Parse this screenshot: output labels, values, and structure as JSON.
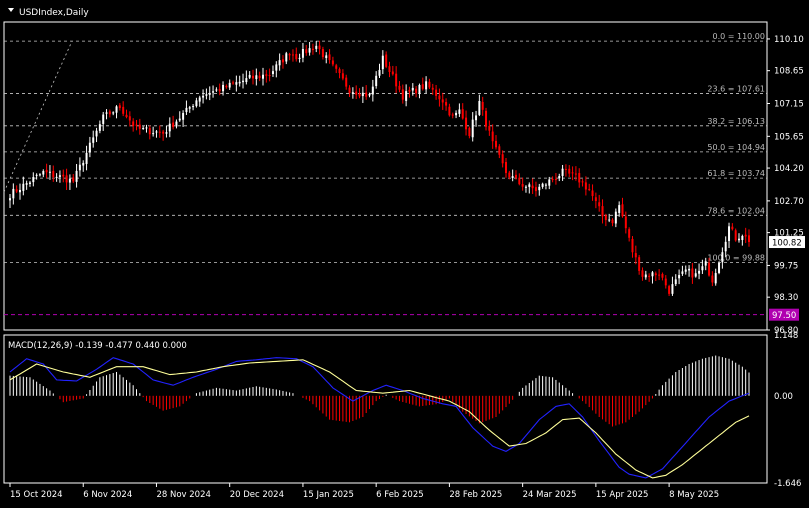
{
  "header": {
    "symbol_label": "USDIndex,Daily",
    "arrow_icon": "triangle-down-icon"
  },
  "colors": {
    "background": "#000000",
    "bull": "#ffffff",
    "bear": "#ff0000",
    "fib_line": "#c8c8c8",
    "macd_line": "#2222ff",
    "signal_line": "#ffff99",
    "level_magenta": "#b000b0",
    "price_box_bg": "#ffffff",
    "price_box_fg": "#000000"
  },
  "chart_data": [
    {
      "type": "candlestick",
      "title": "USDIndex,Daily",
      "ylim": [
        96.8,
        110.6
      ],
      "y_ticks": [
        110.1,
        108.65,
        107.15,
        105.65,
        104.2,
        102.7,
        101.25,
        99.75,
        98.3,
        96.8
      ],
      "x_ticks": [
        "15 Oct 2024",
        "6 Nov 2024",
        "28 Nov 2024",
        "20 Dec 2024",
        "15 Jan 2025",
        "6 Feb 2025",
        "28 Feb 2025",
        "24 Mar 2025",
        "15 Apr 2025",
        "8 May 2025"
      ],
      "current_price": 100.82,
      "level_marker": 97.5,
      "fib_levels": [
        {
          "label": "0.0 = 110.00",
          "value": 110.0
        },
        {
          "label": "23.6 = 107.61",
          "value": 107.61
        },
        {
          "label": "38.2 = 106.13",
          "value": 106.13
        },
        {
          "label": "50.0 = 104.94",
          "value": 104.94
        },
        {
          "label": "61.8 = 103.74",
          "value": 103.74
        },
        {
          "label": "78.6 = 102.04",
          "value": 102.04
        },
        {
          "label": "100.0 = 99.88",
          "value": 99.88
        }
      ],
      "anchors": [
        [
          0,
          103.0
        ],
        [
          10,
          104.0
        ],
        [
          15,
          103.8
        ],
        [
          19,
          103.6
        ],
        [
          28,
          106.5
        ],
        [
          33,
          107.0
        ],
        [
          38,
          106.0
        ],
        [
          46,
          105.8
        ],
        [
          53,
          106.8
        ],
        [
          57,
          107.5
        ],
        [
          63,
          107.8
        ],
        [
          72,
          108.3
        ],
        [
          78,
          108.5
        ],
        [
          84,
          109.5
        ],
        [
          86,
          109.3
        ],
        [
          92,
          109.8
        ],
        [
          98,
          108.6
        ],
        [
          102,
          107.8
        ],
        [
          108,
          107.5
        ],
        [
          112,
          109.2
        ],
        [
          118,
          107.5
        ],
        [
          125,
          108.0
        ],
        [
          130,
          107.3
        ],
        [
          133,
          106.5
        ],
        [
          135,
          106.8
        ],
        [
          138,
          105.8
        ],
        [
          141,
          107.2
        ],
        [
          145,
          105.3
        ],
        [
          149,
          104.0
        ],
        [
          153,
          103.5
        ],
        [
          158,
          103.2
        ],
        [
          162,
          103.6
        ],
        [
          166,
          104.0
        ],
        [
          170,
          103.8
        ],
        [
          174,
          103.2
        ],
        [
          178,
          102.0
        ],
        [
          181,
          101.8
        ],
        [
          183,
          102.5
        ],
        [
          187,
          100.4
        ],
        [
          190,
          99.3
        ],
        [
          195,
          99.4
        ],
        [
          198,
          98.6
        ],
        [
          200,
          99.0
        ],
        [
          203,
          99.5
        ],
        [
          206,
          99.3
        ],
        [
          209,
          99.8
        ],
        [
          211,
          99.1
        ],
        [
          213,
          100.0
        ],
        [
          216,
          101.5
        ],
        [
          218,
          101.0
        ],
        [
          220,
          101.2
        ],
        [
          222,
          100.82
        ]
      ],
      "macd": {
        "label": "MACD(12,26,9) -0.139 -0.477 0.440 0.000",
        "ylim": [
          -1.646,
          1.148
        ],
        "y_ticks": [
          1.148,
          0.0,
          -1.646
        ],
        "hist_anchors": [
          [
            0,
            0.38
          ],
          [
            6,
            0.35
          ],
          [
            12,
            0.1
          ],
          [
            16,
            -0.12
          ],
          [
            22,
            -0.05
          ],
          [
            27,
            0.35
          ],
          [
            32,
            0.45
          ],
          [
            37,
            0.2
          ],
          [
            41,
            -0.1
          ],
          [
            46,
            -0.28
          ],
          [
            51,
            -0.2
          ],
          [
            56,
            0.05
          ],
          [
            62,
            0.15
          ],
          [
            68,
            0.1
          ],
          [
            74,
            0.18
          ],
          [
            80,
            0.12
          ],
          [
            85,
            0.05
          ],
          [
            90,
            -0.1
          ],
          [
            96,
            -0.45
          ],
          [
            102,
            -0.5
          ],
          [
            106,
            -0.4
          ],
          [
            110,
            -0.1
          ],
          [
            113,
            0.02
          ],
          [
            117,
            -0.1
          ],
          [
            123,
            -0.2
          ],
          [
            129,
            -0.15
          ],
          [
            132,
            -0.05
          ],
          [
            136,
            -0.3
          ],
          [
            141,
            -0.52
          ],
          [
            146,
            -0.4
          ],
          [
            150,
            -0.15
          ],
          [
            154,
            0.15
          ],
          [
            159,
            0.38
          ],
          [
            163,
            0.35
          ],
          [
            166,
            0.2
          ],
          [
            169,
            0.05
          ],
          [
            173,
            -0.15
          ],
          [
            177,
            -0.4
          ],
          [
            181,
            -0.58
          ],
          [
            185,
            -0.5
          ],
          [
            189,
            -0.3
          ],
          [
            193,
            -0.05
          ],
          [
            196,
            0.2
          ],
          [
            200,
            0.45
          ],
          [
            204,
            0.6
          ],
          [
            208,
            0.7
          ],
          [
            212,
            0.76
          ],
          [
            216,
            0.7
          ],
          [
            220,
            0.55
          ],
          [
            222,
            0.44
          ]
        ],
        "macd_anchors": [
          [
            0,
            0.45
          ],
          [
            5,
            0.7
          ],
          [
            10,
            0.6
          ],
          [
            14,
            0.3
          ],
          [
            20,
            0.28
          ],
          [
            26,
            0.5
          ],
          [
            31,
            0.72
          ],
          [
            37,
            0.6
          ],
          [
            43,
            0.3
          ],
          [
            49,
            0.2
          ],
          [
            55,
            0.35
          ],
          [
            62,
            0.5
          ],
          [
            68,
            0.65
          ],
          [
            74,
            0.68
          ],
          [
            80,
            0.72
          ],
          [
            86,
            0.7
          ],
          [
            91,
            0.55
          ],
          [
            97,
            0.15
          ],
          [
            103,
            -0.1
          ],
          [
            109,
            0.1
          ],
          [
            113,
            0.2
          ],
          [
            118,
            0.1
          ],
          [
            124,
            -0.05
          ],
          [
            130,
            -0.15
          ],
          [
            134,
            -0.2
          ],
          [
            139,
            -0.6
          ],
          [
            145,
            -0.95
          ],
          [
            149,
            -1.05
          ],
          [
            153,
            -0.9
          ],
          [
            159,
            -0.45
          ],
          [
            164,
            -0.2
          ],
          [
            168,
            -0.15
          ],
          [
            172,
            -0.4
          ],
          [
            177,
            -0.85
          ],
          [
            183,
            -1.35
          ],
          [
            186,
            -1.48
          ],
          [
            191,
            -1.55
          ],
          [
            196,
            -1.38
          ],
          [
            200,
            -1.1
          ],
          [
            205,
            -0.75
          ],
          [
            210,
            -0.4
          ],
          [
            216,
            -0.1
          ],
          [
            222,
            0.05
          ]
        ],
        "signal_anchors": [
          [
            0,
            0.3
          ],
          [
            8,
            0.6
          ],
          [
            16,
            0.45
          ],
          [
            24,
            0.35
          ],
          [
            32,
            0.55
          ],
          [
            40,
            0.55
          ],
          [
            48,
            0.4
          ],
          [
            56,
            0.45
          ],
          [
            64,
            0.55
          ],
          [
            72,
            0.62
          ],
          [
            80,
            0.65
          ],
          [
            88,
            0.68
          ],
          [
            96,
            0.45
          ],
          [
            104,
            0.1
          ],
          [
            112,
            0.05
          ],
          [
            120,
            0.1
          ],
          [
            126,
            0.0
          ],
          [
            132,
            -0.1
          ],
          [
            138,
            -0.3
          ],
          [
            144,
            -0.65
          ],
          [
            150,
            -0.95
          ],
          [
            155,
            -0.9
          ],
          [
            161,
            -0.7
          ],
          [
            166,
            -0.45
          ],
          [
            171,
            -0.42
          ],
          [
            176,
            -0.7
          ],
          [
            182,
            -1.1
          ],
          [
            188,
            -1.4
          ],
          [
            193,
            -1.55
          ],
          [
            197,
            -1.5
          ],
          [
            202,
            -1.3
          ],
          [
            208,
            -1.0
          ],
          [
            214,
            -0.7
          ],
          [
            218,
            -0.5
          ],
          [
            222,
            -0.38
          ]
        ]
      }
    }
  ]
}
